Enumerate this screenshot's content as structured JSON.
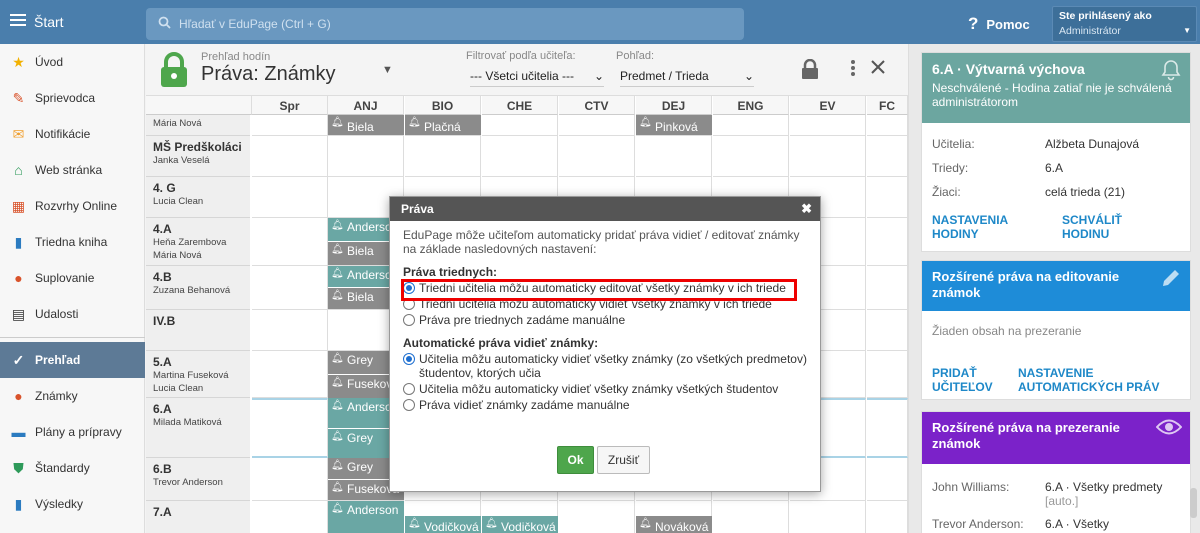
{
  "topbar": {
    "home_label": "Štart",
    "search_placeholder": "Hľadať v EduPage (Ctrl + G)",
    "help_label": "Pomoc",
    "user_line1": "Ste prihlásený ako",
    "user_line2": "Administrátor"
  },
  "sidebar": {
    "items": [
      {
        "label": "Úvod",
        "icon": "star-icon"
      },
      {
        "label": "Sprievodca",
        "icon": "wand-icon"
      },
      {
        "label": "Notifikácie",
        "icon": "envelope-icon"
      },
      {
        "label": "Web stránka",
        "icon": "home-icon"
      },
      {
        "label": "Rozvrhy Online",
        "icon": "calendar-grid-icon"
      },
      {
        "label": "Triedna kniha",
        "icon": "book-icon"
      },
      {
        "label": "Suplovanie",
        "icon": "person-swap-icon"
      },
      {
        "label": "Udalosti",
        "icon": "calendar-icon"
      },
      {
        "label": "Prehľad",
        "icon": "check-circle-icon"
      },
      {
        "label": "Známky",
        "icon": "grade-icon"
      },
      {
        "label": "Plány a prípravy",
        "icon": "briefcase-icon"
      },
      {
        "label": "Štandardy",
        "icon": "shield-check-icon"
      },
      {
        "label": "Výsledky",
        "icon": "bar-chart-icon"
      }
    ]
  },
  "header": {
    "supertitle": "Prehľad hodín",
    "title": "Práva: Známky",
    "filter_label": "Filtrovať podľa učiteľa:",
    "filter_value": "--- Všetci učitelia ---",
    "view_label": "Pohľad:",
    "view_value": "Predmet / Trieda"
  },
  "grid": {
    "columns": [
      "Spr",
      "ANJ",
      "BIO",
      "CHE",
      "CTV",
      "DEJ",
      "ENG",
      "EV",
      "FC"
    ],
    "rows": [
      {
        "class": "",
        "teachers": [
          "Mária Nová"
        ]
      },
      {
        "class": "MŠ Predškoláci",
        "teachers": [
          "Janka Veselá"
        ]
      },
      {
        "class": "4. G",
        "teachers": [
          "Lucia  Clean"
        ]
      },
      {
        "class": "4.A",
        "teachers": [
          "Heňa Zarembova",
          "Mária Nová"
        ]
      },
      {
        "class": "4.B",
        "teachers": [
          "Zuzana Behanová"
        ]
      },
      {
        "class": "IV.B",
        "teachers": []
      },
      {
        "class": "5.A",
        "teachers": [
          "Martina Fuseková",
          "Lucia  Clean"
        ]
      },
      {
        "class": "6.A",
        "teachers": [
          "Milada Matiková"
        ]
      },
      {
        "class": "6.B",
        "teachers": [
          "Trevor Anderson"
        ]
      },
      {
        "class": "7.A",
        "teachers": []
      }
    ],
    "cards": [
      {
        "label": "Biela"
      },
      {
        "label": "Plačná"
      },
      {
        "label": "Pinková"
      },
      {
        "label": "Anderson"
      },
      {
        "label": "Biela"
      },
      {
        "label": "Anderson"
      },
      {
        "label": "Biela"
      },
      {
        "label": "Grey"
      },
      {
        "label": "Fuseková"
      },
      {
        "label": "Anderson"
      },
      {
        "label": "Grey"
      },
      {
        "label": "Grey"
      },
      {
        "label": "Fuseková"
      },
      {
        "label": "Anderson"
      },
      {
        "label": "Vodičková"
      },
      {
        "label": "Vodičková"
      },
      {
        "label": "Nováková"
      }
    ]
  },
  "dialog": {
    "title": "Práva",
    "intro": "EduPage môže učiteľom automaticky pridať práva vidieť / editovať známky na základe nasledovných nastavení:",
    "section1": "Práva triednych:",
    "options1": [
      "Triedni učitelia môžu automaticky editovať všetky známky v ich triede",
      "Triedni učitelia môžu automaticky vidieť všetky známky v ich triede",
      "Práva pre triednych zadáme manuálne"
    ],
    "section2": "Automatické práva vidieť známky:",
    "options2": [
      "Učitelia môžu automaticky vidieť všetky známky (zo všetkých predmetov) študentov, ktorých učia",
      "Učitelia môžu automaticky vidieť všetky známky všetkých študentov",
      "Práva vidieť známky zadáme manuálne"
    ],
    "ok": "Ok",
    "cancel": "Zrušiť"
  },
  "right_panel": {
    "box1": {
      "title": "6.A · Výtvarná výchova",
      "subtitle": "Neschválené - Hodina zatiaľ nie je schválená administrátorom",
      "k1": "Učitelia:",
      "v1": "Alžbeta Dunajová",
      "k2": "Triedy:",
      "v2": "6.A",
      "k3": "Žiaci:",
      "v3": "celá trieda (21)",
      "link1": "NASTAVENIA HODINY",
      "link2": "SCHVÁLIŤ HODINU",
      "color": "#6ca6a0"
    },
    "box2": {
      "title": "Rozšírené práva na editovanie známok",
      "empty": "Žiaden obsah na prezeranie",
      "link1": "PRIDAŤ UČITEĽOV",
      "link2": "NASTAVENIE AUTOMATICKÝCH PRÁV",
      "color": "#1e8cd8"
    },
    "box3": {
      "title": "Rozšírené práva na prezeranie známok",
      "k1": "John Williams:",
      "v1": "6.A · Všetky predmety",
      "v1b": "[auto.]",
      "k2": "Trevor Anderson:",
      "v2": "6.A · Všetky",
      "color": "#7b22c9"
    }
  }
}
